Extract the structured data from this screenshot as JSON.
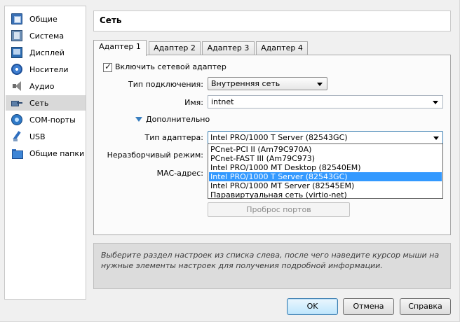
{
  "sidebar": {
    "items": [
      {
        "label": "Общие",
        "icon": "general-icon"
      },
      {
        "label": "Система",
        "icon": "system-icon"
      },
      {
        "label": "Дисплей",
        "icon": "display-icon"
      },
      {
        "label": "Носители",
        "icon": "storage-icon"
      },
      {
        "label": "Аудио",
        "icon": "audio-icon"
      },
      {
        "label": "Сеть",
        "icon": "network-icon",
        "selected": true
      },
      {
        "label": "COM-порты",
        "icon": "com-ports-icon"
      },
      {
        "label": "USB",
        "icon": "usb-icon"
      },
      {
        "label": "Общие папки",
        "icon": "shared-folders-icon"
      }
    ]
  },
  "header": {
    "title": "Сеть"
  },
  "tabs": [
    {
      "label": "Адаптер 1",
      "active": true
    },
    {
      "label": "Адаптер 2"
    },
    {
      "label": "Адаптер 3"
    },
    {
      "label": "Адаптер 4"
    }
  ],
  "form": {
    "enable_adapter_label": "Включить сетевой адаптер",
    "enable_adapter_checked": true,
    "attachment_label": "Тип подключения:",
    "attachment_value": "Внутренняя сеть",
    "name_label": "Имя:",
    "name_value": "intnet",
    "advanced_label": "Дополнительно",
    "adapter_type_label": "Тип адаптера:",
    "adapter_type_value": "Intel PRO/1000 T Server (82543GC)",
    "promiscuous_label": "Неразборчивый режим:",
    "mac_label": "MAC-адрес:",
    "port_forwarding_label": "Проброс портов"
  },
  "adapter_dropdown": {
    "options": [
      "PCnet-PCI II (Am79C970A)",
      "PCnet-FAST III (Am79C973)",
      "Intel PRO/1000 MT Desktop (82540EM)",
      "Intel PRO/1000 T Server (82543GC)",
      "Intel PRO/1000 MT Server (82545EM)",
      "Паравиртуальная сеть (virtio-net)"
    ],
    "selected_index": 3
  },
  "info": {
    "text": "Выберите раздел настроек из списка слева, после чего наведите курсор мыши на нужные элементы настроек для получения подробной информации."
  },
  "buttons": {
    "ok": "OK",
    "cancel": "Отмена",
    "help": "Справка"
  },
  "colors": {
    "selection": "#3399ff",
    "sidebar_selected": "#d9d9d9",
    "focus_border": "#3c7fb1"
  }
}
